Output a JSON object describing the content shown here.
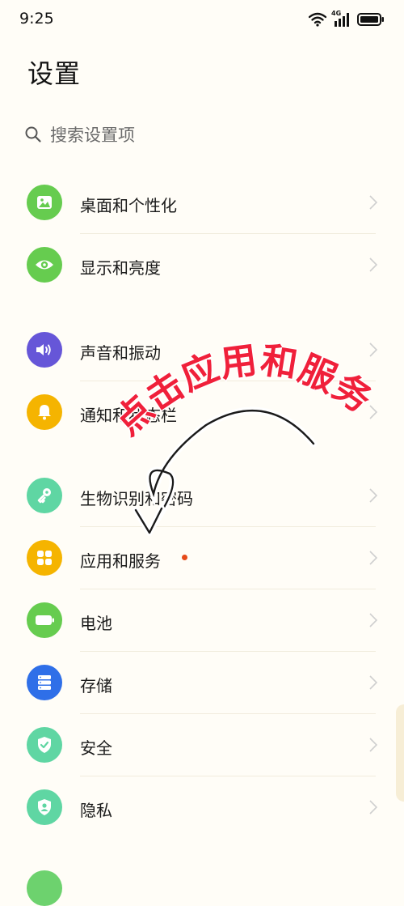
{
  "status_bar": {
    "time": "9:25",
    "network_label": "4G"
  },
  "page": {
    "title": "设置"
  },
  "search": {
    "placeholder": "搜索设置项"
  },
  "items": [
    {
      "label": "桌面和个性化",
      "icon": "wallpaper-icon",
      "color": "#66cc4f"
    },
    {
      "label": "显示和亮度",
      "icon": "eye-icon",
      "color": "#66cc4f"
    },
    {
      "label": "声音和振动",
      "icon": "speaker-icon",
      "color": "#6656d8"
    },
    {
      "label": "通知和状态栏",
      "icon": "bell-icon",
      "color": "#f5b400"
    },
    {
      "label": "生物识别和密码",
      "icon": "key-icon",
      "color": "#5fd6a3"
    },
    {
      "label": "应用和服务",
      "icon": "apps-icon",
      "color": "#f5b400",
      "badge": true
    },
    {
      "label": "电池",
      "icon": "battery-icon",
      "color": "#66cc4f"
    },
    {
      "label": "存储",
      "icon": "storage-icon",
      "color": "#2f6fe8"
    },
    {
      "label": "安全",
      "icon": "shield-check-icon",
      "color": "#5fd6a3"
    },
    {
      "label": "隐私",
      "icon": "privacy-shield-icon",
      "color": "#5fd6a3"
    }
  ],
  "annotation": {
    "text": "点击应用和服务",
    "color": "#f0203a"
  }
}
